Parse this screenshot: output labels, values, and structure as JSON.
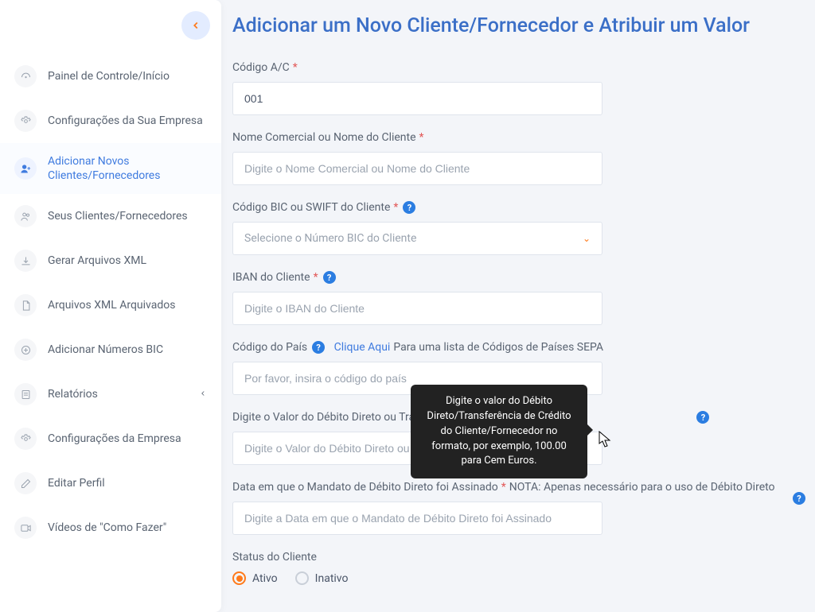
{
  "colors": {
    "accent": "#ff7a1a",
    "link": "#3f7bdf",
    "title": "#3b6fc7",
    "help": "#2b7de1",
    "required": "#e25858"
  },
  "sidebar": {
    "items": [
      {
        "icon": "dashboard-icon",
        "label": "Painel de Controle/Início"
      },
      {
        "icon": "gear-icon",
        "label": "Configurações da Sua Empresa"
      },
      {
        "icon": "user-plus-icon",
        "label": "Adicionar Novos Clientes/Fornecedores",
        "active": true
      },
      {
        "icon": "users-icon",
        "label": "Seus Clientes/Fornecedores"
      },
      {
        "icon": "download-icon",
        "label": "Gerar Arquivos XML"
      },
      {
        "icon": "file-icon",
        "label": "Arquivos XML Arquivados"
      },
      {
        "icon": "plus-circle-icon",
        "label": "Adicionar Números BIC"
      },
      {
        "icon": "report-icon",
        "label": "Relatórios",
        "hasSub": true
      },
      {
        "icon": "gear-icon",
        "label": "Configurações da Empresa"
      },
      {
        "icon": "edit-icon",
        "label": "Editar Perfil"
      },
      {
        "icon": "video-icon",
        "label": "Vídeos de \"Como Fazer\""
      }
    ]
  },
  "page": {
    "title": "Adicionar um Novo Cliente/Fornecedor e Atribuir um Valor"
  },
  "form": {
    "ac_code": {
      "label": "Código A/C",
      "value": "001"
    },
    "trade_name": {
      "label": "Nome Comercial ou Nome do Cliente",
      "placeholder": "Digite o Nome Comercial ou Nome do Cliente"
    },
    "bic": {
      "label": "Código BIC ou SWIFT do Cliente",
      "placeholder": "Selecione o Número BIC do Cliente"
    },
    "iban": {
      "label": "IBAN do Cliente",
      "placeholder": "Digite o IBAN do Cliente"
    },
    "country": {
      "label": "Código do País",
      "link": "Clique Aqui",
      "after": "Para uma lista de Códigos de Países SEPA",
      "placeholder": "Por favor, insira o código do país"
    },
    "amount": {
      "label": "Digite o Valor do Débito Direto ou Transferência de Crédito",
      "placeholder": "Digite o Valor do Débito Direto ou Transferência de Crédito do Cliente"
    },
    "mandate_date": {
      "label": "Data em que o Mandato de Débito Direto foi Assinado",
      "note": "NOTA: Apenas necessário para o uso de Débito Direto",
      "placeholder": "Digite a Data em que o Mandato de Débito Direto foi Assinado"
    },
    "status": {
      "label": "Status do Cliente",
      "active": "Ativo",
      "inactive": "Inativo",
      "value": "Ativo"
    }
  },
  "tooltip": {
    "text": "Digite o valor do Débito Direto/Transferência de Crédito do Cliente/Fornecedor no formato, por exemplo, 100.00 para Cem Euros."
  }
}
